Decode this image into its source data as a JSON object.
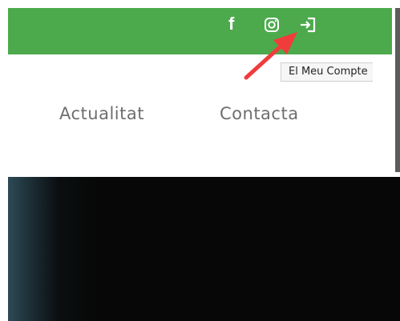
{
  "header": {
    "social": [
      {
        "icon": "facebook-icon",
        "glyph": "f"
      },
      {
        "icon": "instagram-icon"
      },
      {
        "icon": "login-icon"
      }
    ]
  },
  "tooltip": {
    "text": "El Meu Compte"
  },
  "nav": {
    "items": [
      {
        "label": "Actualitat"
      },
      {
        "label": "Contacta"
      }
    ]
  },
  "colors": {
    "topbar": "#4caa4c",
    "nav_text": "#6e6e6e",
    "annotation_arrow": "#f03c3c",
    "hero_background": "#070707"
  }
}
